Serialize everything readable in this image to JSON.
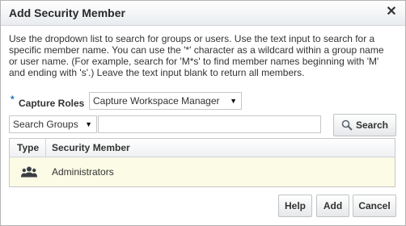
{
  "dialog": {
    "title": "Add Security Member",
    "close_glyph": "✕",
    "description": "Use the dropdown list to search for groups or users. Use the text input to search for a specific member name. You can use the '*' character as a wildcard within a group name or user name. (For example, search for 'M*s' to find member names beginning with 'M' and ending with 's'.) Leave the text input blank to return all members."
  },
  "capture_roles": {
    "required_marker": "*",
    "label": "Capture Roles",
    "selected": "Capture Workspace Manager",
    "arrow_icon": "dropdown-arrow-icon"
  },
  "search": {
    "type_selected": "Search Groups",
    "input_value": "",
    "button_label": "Search",
    "icon": "magnifier-icon"
  },
  "table": {
    "headers": {
      "type": "Type",
      "member": "Security Member"
    },
    "rows": [
      {
        "type_icon": "group-icon",
        "member": "Administrators"
      }
    ]
  },
  "footer": {
    "help_label": "Help",
    "add_label": "Add",
    "cancel_label": "Cancel"
  }
}
